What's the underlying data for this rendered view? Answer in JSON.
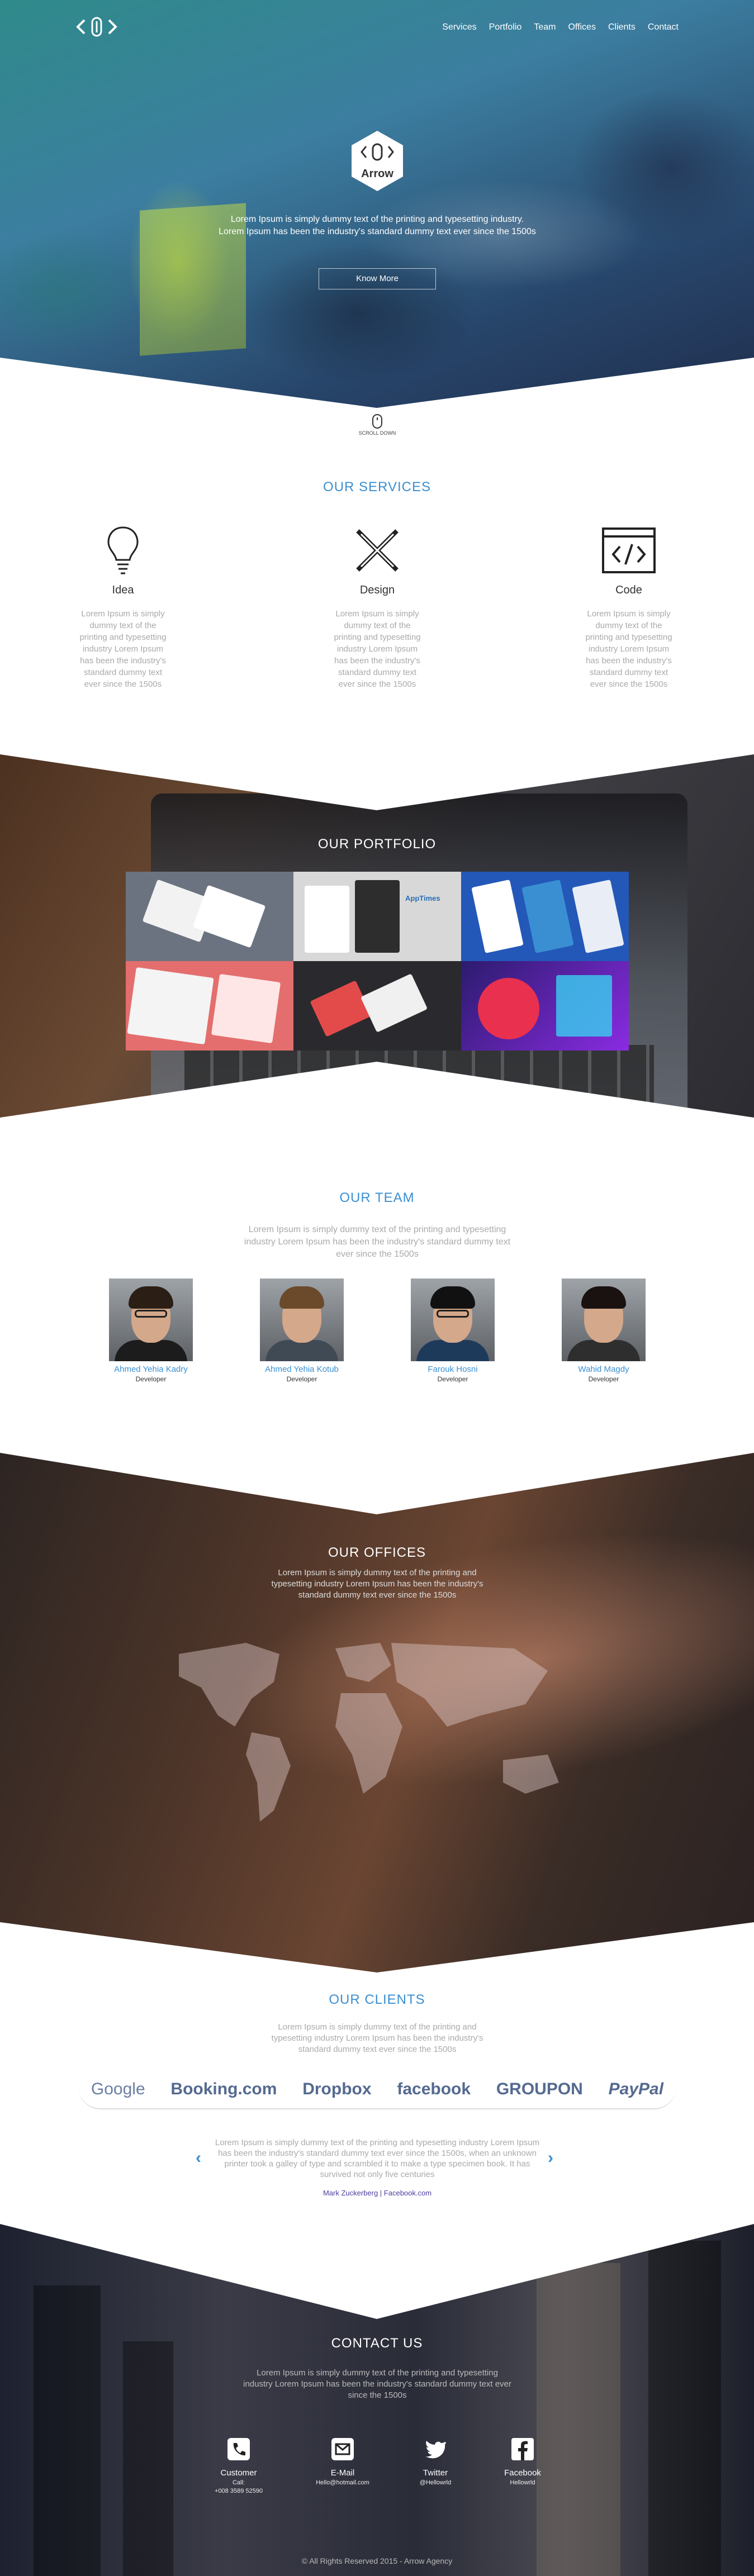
{
  "nav": {
    "logo": "<>",
    "links": [
      "Services",
      "Portfolio",
      "Team",
      "Offices",
      "Clients",
      "Contact"
    ]
  },
  "hero": {
    "brand": "Arrow",
    "text": "Lorem Ipsum is simply dummy text of the printing and typesetting industry. Lorem Ipsum has been the industry's standard dummy text ever since the 1500s",
    "button": "Know More",
    "scroll": "SCROLL DOWN"
  },
  "services": {
    "title": "OUR SERVICES",
    "items": [
      {
        "name": "Idea",
        "icon": "lightbulb-icon",
        "desc": "Lorem Ipsum is simply dummy text of the printing and typesetting industry Lorem Ipsum has been the industry's standard dummy text ever since the 1500s"
      },
      {
        "name": "Design",
        "icon": "pencil-ruler-icon",
        "desc": "Lorem Ipsum is simply dummy text of the printing and typesetting industry Lorem Ipsum has been the industry's standard dummy text ever since the 1500s"
      },
      {
        "name": "Code",
        "icon": "code-window-icon",
        "desc": "Lorem Ipsum is simply dummy text of the printing and typesetting industry Lorem Ipsum has been the industry's standard dummy text ever since the 1500s"
      }
    ]
  },
  "portfolio": {
    "title": "OUR PORTFOLIO",
    "tile_texts": [
      "AppTimes"
    ]
  },
  "team": {
    "title": "OUR TEAM",
    "intro": "Lorem Ipsum is simply dummy text of the printing and typesetting industry Lorem Ipsum has been the industry's standard dummy text ever since the 1500s",
    "members": [
      {
        "name": "Ahmed Yehia Kadry",
        "role": "Developer"
      },
      {
        "name": "Ahmed Yehia Kotub",
        "role": "Developer"
      },
      {
        "name": "Farouk Hosni",
        "role": "Developer"
      },
      {
        "name": "Wahid Magdy",
        "role": "Developer"
      }
    ]
  },
  "offices": {
    "title": "OUR OFFICES",
    "text": "Lorem Ipsum is simply dummy text of the printing and typesetting industry Lorem Ipsum has been the industry's standard dummy text ever since the 1500s"
  },
  "clients": {
    "title": "OUR CLIENTS",
    "text": "Lorem Ipsum is simply dummy text of the printing and typesetting industry Lorem Ipsum has been the industry's standard dummy text ever since the 1500s",
    "logos": [
      "Google",
      "Booking.com",
      "Dropbox",
      "facebook",
      "GROUPON",
      "PayPal"
    ],
    "quote": "Lorem Ipsum is simply dummy text of the printing and typesetting industry Lorem Ipsum has been the industry's standard dummy text ever since the 1500s, when an unknown printer took a galley of type and scrambled it to make a type specimen book. It has survived not only five centuries",
    "quote_link": "Mark Zuckerberg | Facebook.com",
    "prev": "‹",
    "next": "›"
  },
  "contact": {
    "title": "CONTACT US",
    "text": "Lorem Ipsum is simply dummy text of the printing and typesetting industry Lorem Ipsum has been the industry's standard dummy text ever since the 1500s",
    "items": [
      {
        "label": "Customer",
        "line1": "Call:",
        "line2": "+008 3589 52590",
        "icon": "phone-icon"
      },
      {
        "label": "E-Mail",
        "line1": "Hello@hotmail.com",
        "line2": "",
        "icon": "email-icon"
      },
      {
        "label": "Twitter",
        "line1": "@Hellowrld",
        "line2": "",
        "icon": "twitter-icon"
      },
      {
        "label": "Facebook",
        "line1": "Hellowrld",
        "line2": "",
        "icon": "facebook-icon"
      }
    ],
    "copyright": "© All Rights Reserved 2015 - Arrow Agency"
  },
  "colors": {
    "accent": "#3a8fd3",
    "hero_start": "#2f8a8a",
    "hero_end": "#1e2a48"
  }
}
